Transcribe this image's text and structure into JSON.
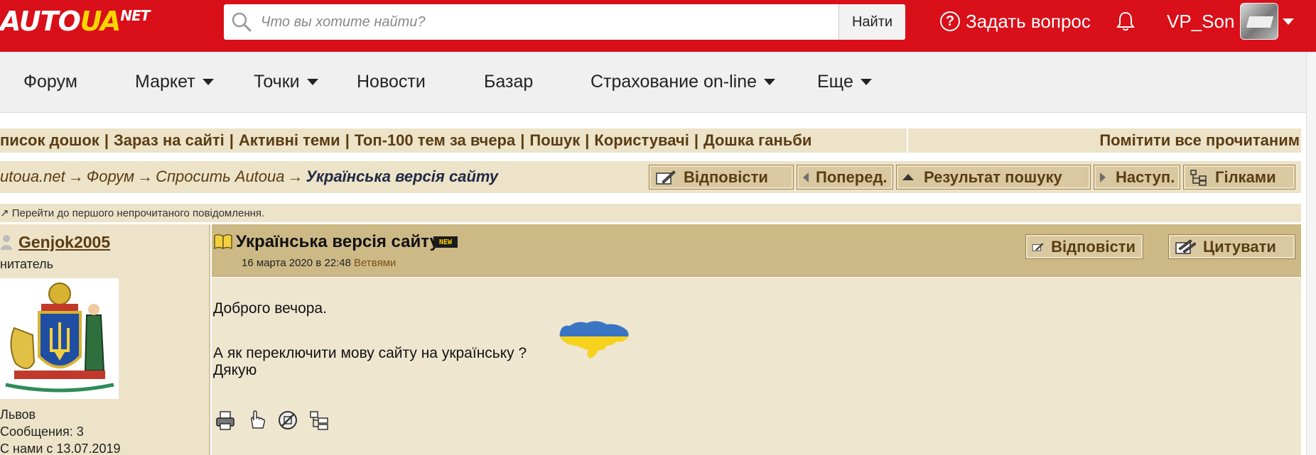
{
  "header": {
    "logo": {
      "part1": "AUTO",
      "part2": "UA",
      "part3": "NET"
    },
    "search": {
      "placeholder": "Что вы хотите найти?",
      "value": "",
      "button_label": "Найти",
      "icon": "search-icon"
    },
    "ask_label": "Задать вопрос",
    "bell_icon": "bell-icon",
    "username": "VP_Son"
  },
  "nav": {
    "items": [
      {
        "label": "Форум",
        "dropdown": false
      },
      {
        "label": "Маркет",
        "dropdown": true
      },
      {
        "label": "Точки",
        "dropdown": true
      },
      {
        "label": "Новости",
        "dropdown": false
      },
      {
        "label": "Базар",
        "dropdown": false
      },
      {
        "label": "Страхование on-line",
        "dropdown": true
      },
      {
        "label": "Еще",
        "dropdown": true
      }
    ]
  },
  "forum": {
    "links": [
      "писок дошок",
      "Зараз на сайті",
      "Активні теми",
      "Топ-100 тем за вчера",
      "Пошук",
      "Користувачі",
      "Дошка ганьби"
    ],
    "separator": "|",
    "mark_all_read": "Помітити все прочитаним",
    "breadcrumb": {
      "items": [
        "utoua.net",
        "Форум",
        "Спросить Autoua"
      ],
      "current": "Українська версія сайту",
      "arrow": "→"
    },
    "buttons": {
      "reply": "Відповісти",
      "prev": "Поперед.",
      "search_result": "Результат пошуку",
      "next": "Наступ.",
      "threads": "Гілками"
    },
    "jump_unread": "↗ Перейти до першого непрочитаного повідомлення."
  },
  "author": {
    "name": "Genjok2005",
    "role": "нитатель",
    "city": "Львов",
    "messages": "Сообщения: 3",
    "since": "С нами с 13.07.2019"
  },
  "post": {
    "title": "Українська версія сайту",
    "badge": "NEW",
    "date": "16 марта 2020 в 22:48",
    "tree_link": "Ветвями",
    "reply_button": "Відповісти",
    "quote_button": "Цитувати",
    "lines": [
      "Доброго вечора.",
      "А як переключити мову сайту на українську ?",
      "Дякую"
    ],
    "tools": [
      "print-icon",
      "hand-pointer-icon",
      "forbidden-icon",
      "threads-icon"
    ]
  },
  "colors": {
    "brand_red": "#d90f19",
    "forum_bg": "#ede3c8",
    "post_header": "#cdb986",
    "link_brown": "#5a3d14"
  }
}
